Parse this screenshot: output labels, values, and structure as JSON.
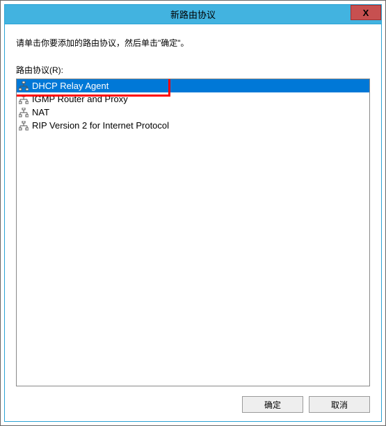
{
  "window": {
    "title": "新路由协议",
    "close_label": "X"
  },
  "content": {
    "instruction": "请单击你要添加的路由协议，然后单击\"确定\"。",
    "list_label": "路由协议(R):",
    "items": [
      {
        "label": "DHCP Relay Agent",
        "selected": true
      },
      {
        "label": "IGMP Router and Proxy",
        "selected": false
      },
      {
        "label": "NAT",
        "selected": false
      },
      {
        "label": "RIP Version 2 for Internet Protocol",
        "selected": false
      }
    ]
  },
  "buttons": {
    "ok": "确定",
    "cancel": "取消"
  },
  "annotation": {
    "highlight_item_index": 0
  }
}
